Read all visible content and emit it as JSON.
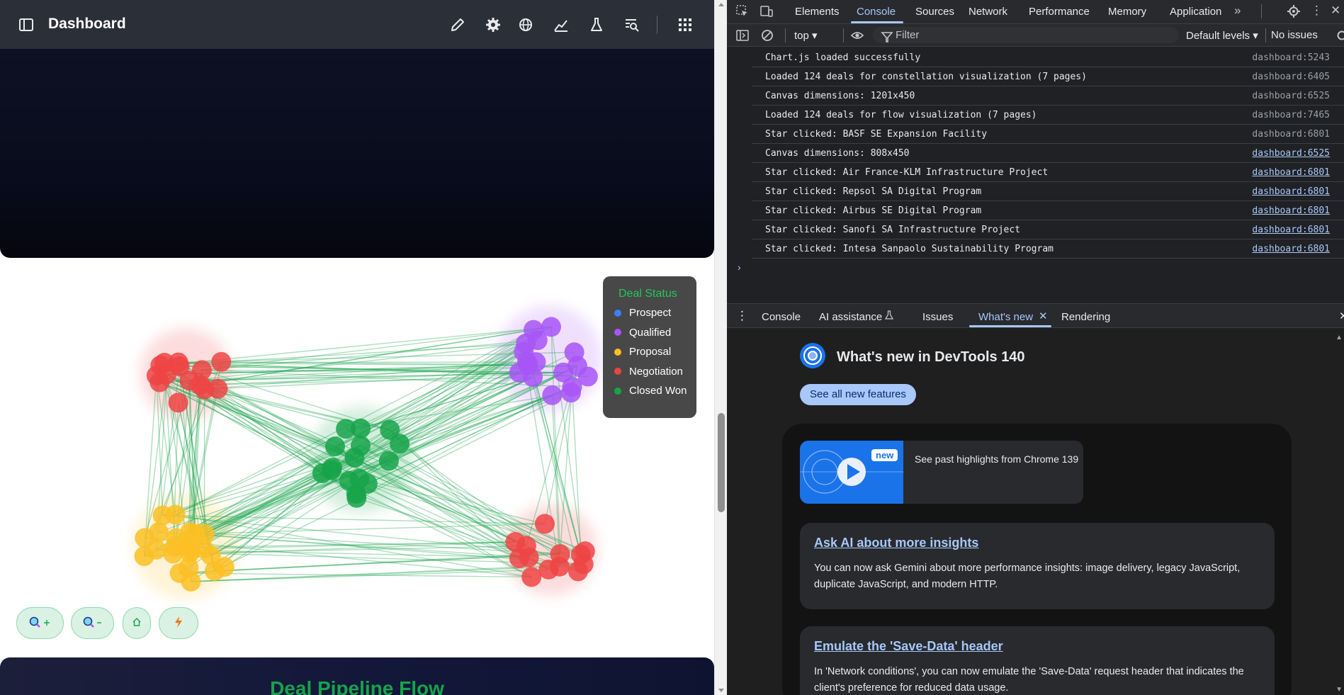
{
  "app": {
    "title": "Dashboard",
    "header_icons": [
      "pencil-icon",
      "gear-icon",
      "globe-icon",
      "chart-line-icon",
      "flask-icon",
      "search-doc-icon",
      "apps-grid-icon"
    ]
  },
  "legend": {
    "title": "Deal Status",
    "items": [
      {
        "label": "Prospect",
        "color": "#3b82f6"
      },
      {
        "label": "Qualified",
        "color": "#a855f7"
      },
      {
        "label": "Proposal",
        "color": "#fbbf24"
      },
      {
        "label": "Negotiation",
        "color": "#ef4444"
      },
      {
        "label": "Closed Won",
        "color": "#16a34a"
      }
    ]
  },
  "zoom_controls": [
    {
      "name": "zoom-in-button",
      "icon": "zoom-in-icon",
      "label": "🔍+"
    },
    {
      "name": "zoom-out-button",
      "icon": "zoom-out-icon",
      "label": "🔍-"
    },
    {
      "name": "home-button",
      "icon": "home-icon",
      "label": "⌂"
    },
    {
      "name": "lightning-button",
      "icon": "lightning-icon",
      "label": "⚡"
    }
  ],
  "flow": {
    "title": "Deal Pipeline Flow"
  },
  "devtools": {
    "tabs": [
      "Elements",
      "Console",
      "Sources",
      "Network",
      "Performance",
      "Memory",
      "Application"
    ],
    "active_tab": "Console",
    "context": "top ▾",
    "filter_placeholder": "Filter",
    "levels": "Default levels ▾",
    "issues": "No issues",
    "logs": [
      {
        "msg": "Chart.js loaded successfully",
        "src": "dashboard:5243",
        "link": false
      },
      {
        "msg": "Loaded 124 deals for constellation visualization (7 pages)",
        "src": "dashboard:6405",
        "link": false
      },
      {
        "msg": "Canvas dimensions: 1201x450",
        "src": "dashboard:6525",
        "link": false
      },
      {
        "msg": "Loaded 124 deals for flow visualization (7 pages)",
        "src": "dashboard:7465",
        "link": false
      },
      {
        "msg": "Star clicked: BASF SE Expansion Facility",
        "src": "dashboard:6801",
        "link": false
      },
      {
        "msg": "Canvas dimensions: 808x450",
        "src": "dashboard:6525",
        "link": true
      },
      {
        "msg": "Star clicked: Air France-KLM Infrastructure Project",
        "src": "dashboard:6801",
        "link": true
      },
      {
        "msg": "Star clicked: Repsol SA Digital Program",
        "src": "dashboard:6801",
        "link": true
      },
      {
        "msg": "Star clicked: Airbus SE Digital Program",
        "src": "dashboard:6801",
        "link": true
      },
      {
        "msg": "Star clicked: Sanofi SA Infrastructure Project",
        "src": "dashboard:6801",
        "link": true
      },
      {
        "msg": "Star clicked: Intesa Sanpaolo Sustainability Program",
        "src": "dashboard:6801",
        "link": true
      }
    ],
    "drawer_tabs": [
      "Console",
      "AI assistance",
      "Issues",
      "What's new",
      "Rendering"
    ],
    "drawer_active": "What's new",
    "whats_new": {
      "title": "What's new in DevTools 140",
      "button": "See all new features",
      "video_badge": "new",
      "video_text": "See past highlights from Chrome 139",
      "features": [
        {
          "title": "Ask AI about more insights",
          "body": "You can now ask Gemini about more performance insights: image delivery, legacy JavaScript, duplicate JavaScript, and modern HTTP."
        },
        {
          "title": "Emulate the 'Save-Data' header",
          "body": "In 'Network conditions', you can now emulate the 'Save-Data' request header that indicates the client's preference for reduced data usage."
        }
      ]
    }
  }
}
